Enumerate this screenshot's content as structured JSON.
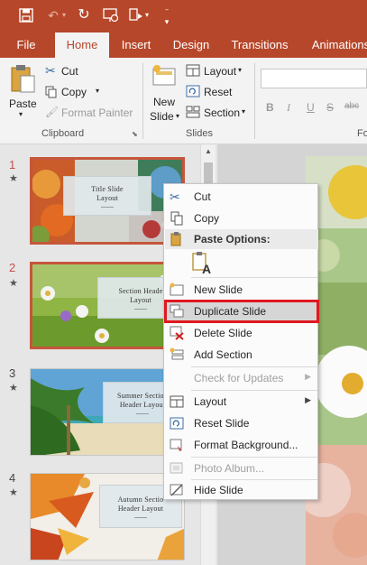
{
  "app": {
    "accent": "#b7472a",
    "qat": [
      "save-icon",
      "undo-icon",
      "redo-icon",
      "slideshow-from-start-icon",
      "touch-mode-icon",
      "customize-qat-icon"
    ]
  },
  "tabs": [
    {
      "label": "File"
    },
    {
      "label": "Home"
    },
    {
      "label": "Insert"
    },
    {
      "label": "Design"
    },
    {
      "label": "Transitions"
    },
    {
      "label": "Animations"
    }
  ],
  "ribbon": {
    "clipboard": {
      "paste": "Paste",
      "cut": "Cut",
      "copy": "Copy",
      "format_painter": "Format Painter",
      "group": "Clipboard"
    },
    "slides": {
      "new_slide": "New",
      "new_slide_2": "Slide",
      "layout": "Layout",
      "reset": "Reset",
      "section": "Section",
      "group": "Slides"
    },
    "font": {
      "bold": "B",
      "italic": "I",
      "underline": "U",
      "strikethrough": "S",
      "shadow": "abc",
      "group_partial": "Fo"
    }
  },
  "slides": [
    {
      "num": "1",
      "title": "Title Slide Layout",
      "selected": true
    },
    {
      "num": "2",
      "title": "Section Header Layout",
      "selected": true
    },
    {
      "num": "3",
      "title": "Summer Section Header Layout",
      "selected": false
    },
    {
      "num": "4",
      "title": "Autumn Section Header Layout",
      "selected": false
    }
  ],
  "slide_thumb_text": {
    "s1_a": "Title Slide",
    "s1_b": "Layout",
    "s2_a": "Section Heade",
    "s2_b": "Layout",
    "s3_a": "Summer Section",
    "s3_b": "Header Layout",
    "s4_a": "Autumn Sectio",
    "s4_b": "Header Layout",
    "star": "★"
  },
  "context_menu": {
    "cut": "Cut",
    "copy": "Copy",
    "paste_options": "Paste Options:",
    "new_slide": "New Slide",
    "duplicate_slide": "Duplicate Slide",
    "delete_slide": "Delete Slide",
    "add_section": "Add Section",
    "check_updates": "Check for Updates",
    "layout": "Layout",
    "reset_slide": "Reset Slide",
    "format_background": "Format Background...",
    "photo_album": "Photo Album...",
    "hide_slide": "Hide Slide"
  }
}
